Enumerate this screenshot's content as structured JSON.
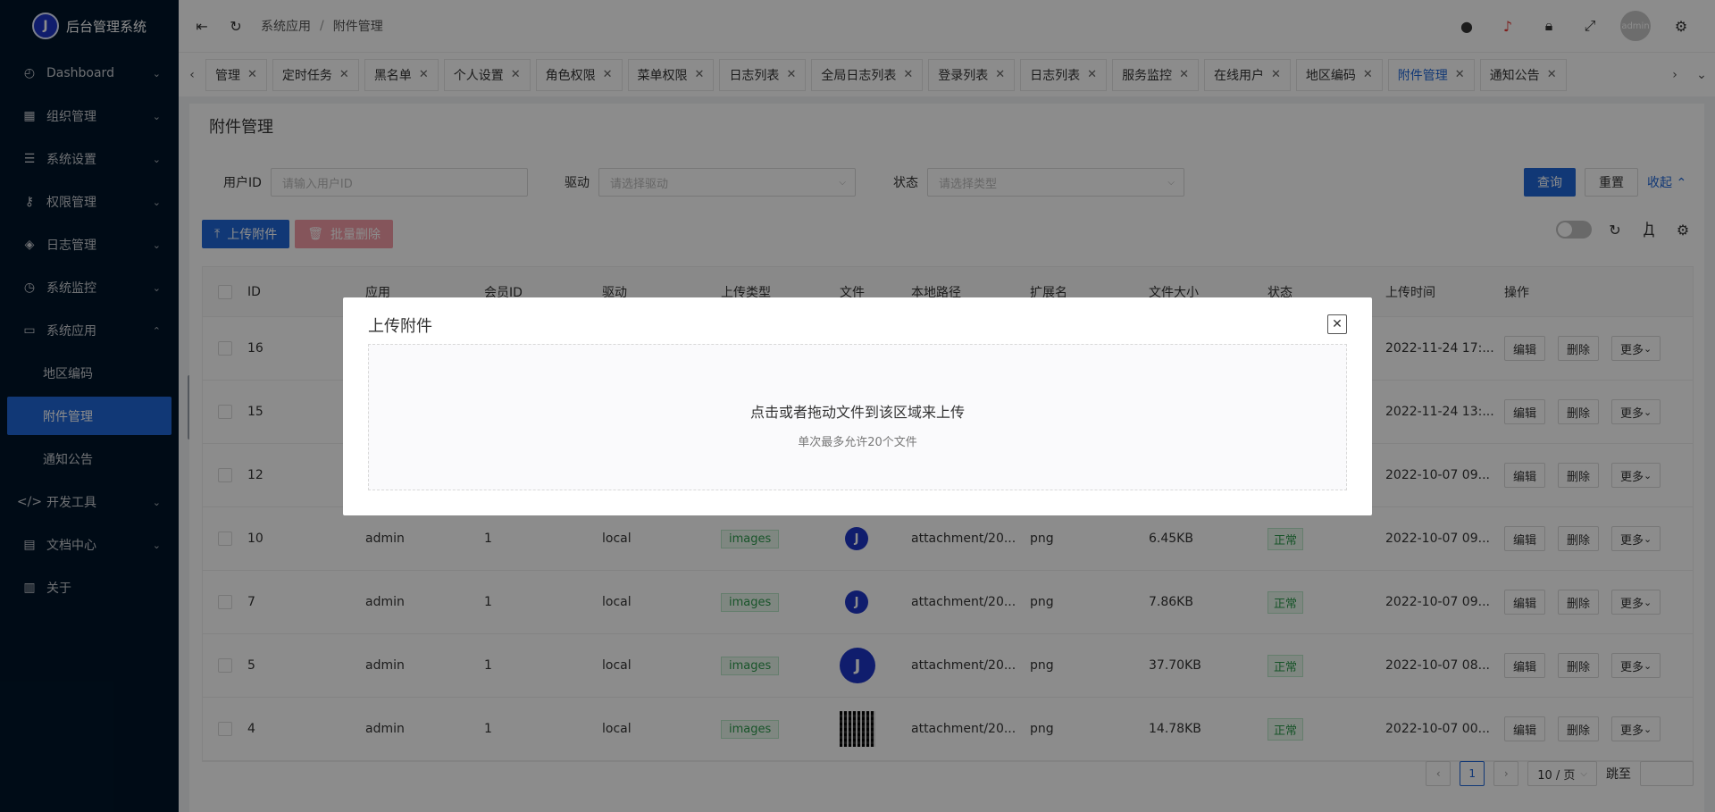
{
  "app": {
    "title": "后台管理系统",
    "logo_letter": "J"
  },
  "sidebar": {
    "items": [
      {
        "name": "dashboard",
        "icon": "gauge-icon",
        "glyph": "◴",
        "label": "Dashboard",
        "expanded": false
      },
      {
        "name": "org",
        "icon": "grid-icon",
        "glyph": "▦",
        "label": "组织管理",
        "expanded": false
      },
      {
        "name": "settings",
        "icon": "sliders-icon",
        "glyph": "☰",
        "label": "系统设置",
        "expanded": false
      },
      {
        "name": "permissions",
        "icon": "key-icon",
        "glyph": "⚷",
        "label": "权限管理",
        "expanded": false
      },
      {
        "name": "logs",
        "icon": "layers-icon",
        "glyph": "◈",
        "label": "日志管理",
        "expanded": false
      },
      {
        "name": "monitor",
        "icon": "clock-icon",
        "glyph": "◷",
        "label": "系统监控",
        "expanded": false
      },
      {
        "name": "apps",
        "icon": "monitor-icon",
        "glyph": "▭",
        "label": "系统应用",
        "expanded": true
      }
    ],
    "sub_items": [
      {
        "label": "地区编码",
        "active": false
      },
      {
        "label": "附件管理",
        "active": true
      },
      {
        "label": "通知公告",
        "active": false
      }
    ],
    "bottom_items": [
      {
        "name": "devtools",
        "icon": "code-icon",
        "glyph": "</>",
        "label": "开发工具",
        "chev": true
      },
      {
        "name": "docs",
        "icon": "document-icon",
        "glyph": "▤",
        "label": "文档中心",
        "chev": true
      },
      {
        "name": "about",
        "icon": "board-icon",
        "glyph": "▥",
        "label": "关于",
        "chev": false
      }
    ]
  },
  "header": {
    "breadcrumb": [
      "系统应用",
      "附件管理"
    ],
    "breadcrumb_sep": "/",
    "avatar_text": "admin"
  },
  "tabs": [
    {
      "label": "管理",
      "active": false
    },
    {
      "label": "定时任务",
      "active": false
    },
    {
      "label": "黑名单",
      "active": false
    },
    {
      "label": "个人设置",
      "active": false
    },
    {
      "label": "角色权限",
      "active": false
    },
    {
      "label": "菜单权限",
      "active": false
    },
    {
      "label": "日志列表",
      "active": false
    },
    {
      "label": "全局日志列表",
      "active": false
    },
    {
      "label": "登录列表",
      "active": false
    },
    {
      "label": "日志列表",
      "active": false
    },
    {
      "label": "服务监控",
      "active": false
    },
    {
      "label": "在线用户",
      "active": false
    },
    {
      "label": "地区编码",
      "active": false
    },
    {
      "label": "附件管理",
      "active": true
    },
    {
      "label": "通知公告",
      "active": false
    }
  ],
  "page": {
    "title": "附件管理"
  },
  "filters": {
    "user_id_label": "用户ID",
    "user_id_placeholder": "请输入用户ID",
    "driver_label": "驱动",
    "driver_placeholder": "请选择驱动",
    "status_label": "状态",
    "status_placeholder": "请选择类型",
    "query_label": "查询",
    "reset_label": "重置",
    "collapse_label": "收起"
  },
  "toolbar": {
    "upload_label": "上传附件",
    "batch_delete_label": "批量删除"
  },
  "table": {
    "columns": [
      "ID",
      "应用",
      "会员ID",
      "驱动",
      "上传类型",
      "文件",
      "本地路径",
      "扩展名",
      "文件大小",
      "状态",
      "上传时间",
      "操作"
    ],
    "rows": [
      {
        "id": "16",
        "app": "",
        "member_id": "",
        "driver": "",
        "type": "",
        "file": "none",
        "path": "",
        "ext": "",
        "size": "",
        "status": "",
        "time": "2022-11-24 17:..."
      },
      {
        "id": "15",
        "app": "",
        "member_id": "",
        "driver": "",
        "type": "",
        "file": "none",
        "path": "",
        "ext": "",
        "size": "",
        "status": "",
        "time": "2022-11-24 13:..."
      },
      {
        "id": "12",
        "app": "",
        "member_id": "",
        "driver": "",
        "type": "",
        "file": "none",
        "path": "",
        "ext": "",
        "size": "",
        "status": "",
        "time": "2022-10-07 09..."
      },
      {
        "id": "10",
        "app": "admin",
        "member_id": "1",
        "driver": "local",
        "type": "images",
        "file": "logo-small",
        "path": "attachment/20...",
        "ext": "png",
        "size": "6.45KB",
        "status": "正常",
        "time": "2022-10-07 09..."
      },
      {
        "id": "7",
        "app": "admin",
        "member_id": "1",
        "driver": "local",
        "type": "images",
        "file": "logo-small",
        "path": "attachment/20...",
        "ext": "png",
        "size": "7.86KB",
        "status": "正常",
        "time": "2022-10-07 09..."
      },
      {
        "id": "5",
        "app": "admin",
        "member_id": "1",
        "driver": "local",
        "type": "images",
        "file": "logo-big",
        "path": "attachment/20...",
        "ext": "png",
        "size": "37.70KB",
        "status": "正常",
        "time": "2022-10-07 08..."
      },
      {
        "id": "4",
        "app": "admin",
        "member_id": "1",
        "driver": "local",
        "type": "images",
        "file": "qr",
        "path": "attachment/20...",
        "ext": "png",
        "size": "14.78KB",
        "status": "正常",
        "time": "2022-10-07 00..."
      }
    ],
    "ops": {
      "edit": "编辑",
      "delete": "删除",
      "more": "更多"
    }
  },
  "pagination": {
    "current_page": "1",
    "page_size": "10 / 页",
    "jump_label": "跳至"
  },
  "dialog": {
    "title": "上传附件",
    "drop_text": "点击或者拖动文件到该区域来上传",
    "drop_hint": "单次最多允许20个文件"
  },
  "colors": {
    "sidebar_bg": "#001529",
    "primary": "#2067d7",
    "danger": "#ef7a8a",
    "success": "#2e9a4d"
  }
}
